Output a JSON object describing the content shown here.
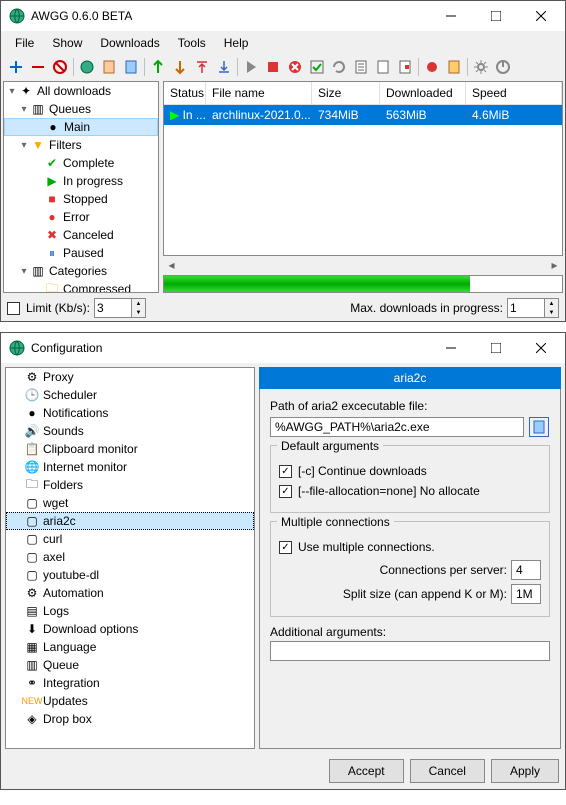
{
  "main": {
    "title": "AWGG 0.6.0 BETA",
    "menu": [
      "File",
      "Show",
      "Downloads",
      "Tools",
      "Help"
    ],
    "tree": {
      "all": "All downloads",
      "queues": "Queues",
      "main_queue": "Main",
      "filters": "Filters",
      "complete": "Complete",
      "inprogress": "In progress",
      "stopped": "Stopped",
      "error": "Error",
      "canceled": "Canceled",
      "paused": "Paused",
      "categories": "Categories",
      "compressed": "Compressed"
    },
    "table": {
      "cols": {
        "status": "Status",
        "name": "File name",
        "size": "Size",
        "dl": "Downloaded",
        "speed": "Speed"
      },
      "row": {
        "status": "In ...",
        "name": "archlinux-2021.0...",
        "size": "734MiB",
        "dl": "563MiB",
        "speed": "4.6MiB"
      }
    },
    "status": {
      "limit_label": "Limit (Kb/s):",
      "limit_value": "3",
      "max_label": "Max. downloads in progress:",
      "max_value": "1"
    }
  },
  "cfg": {
    "title": "Configuration",
    "items": [
      "Proxy",
      "Scheduler",
      "Notifications",
      "Sounds",
      "Clipboard monitor",
      "Internet monitor",
      "Folders",
      "wget",
      "aria2c",
      "curl",
      "axel",
      "youtube-dl",
      "Automation",
      "Logs",
      "Download options",
      "Language",
      "Queue",
      "Integration",
      "Updates",
      "Drop box"
    ],
    "panel": {
      "title": "aria2c",
      "path_label": "Path of aria2 excecutable file:",
      "path_value": "%AWGG_PATH%\\aria2c.exe",
      "defargs_label": "Default arguments",
      "cont_label": "[-c] Continue downloads",
      "noalloc_label": "[--file-allocation=none] No allocate",
      "multi_label": "Multiple connections",
      "usemulti_label": "Use multiple connections.",
      "conn_label": "Connections per server:",
      "conn_value": "4",
      "split_label": "Split size (can append K or M):",
      "split_value": "1M",
      "addargs_label": "Additional arguments:"
    },
    "buttons": {
      "accept": "Accept",
      "cancel": "Cancel",
      "apply": "Apply"
    }
  }
}
